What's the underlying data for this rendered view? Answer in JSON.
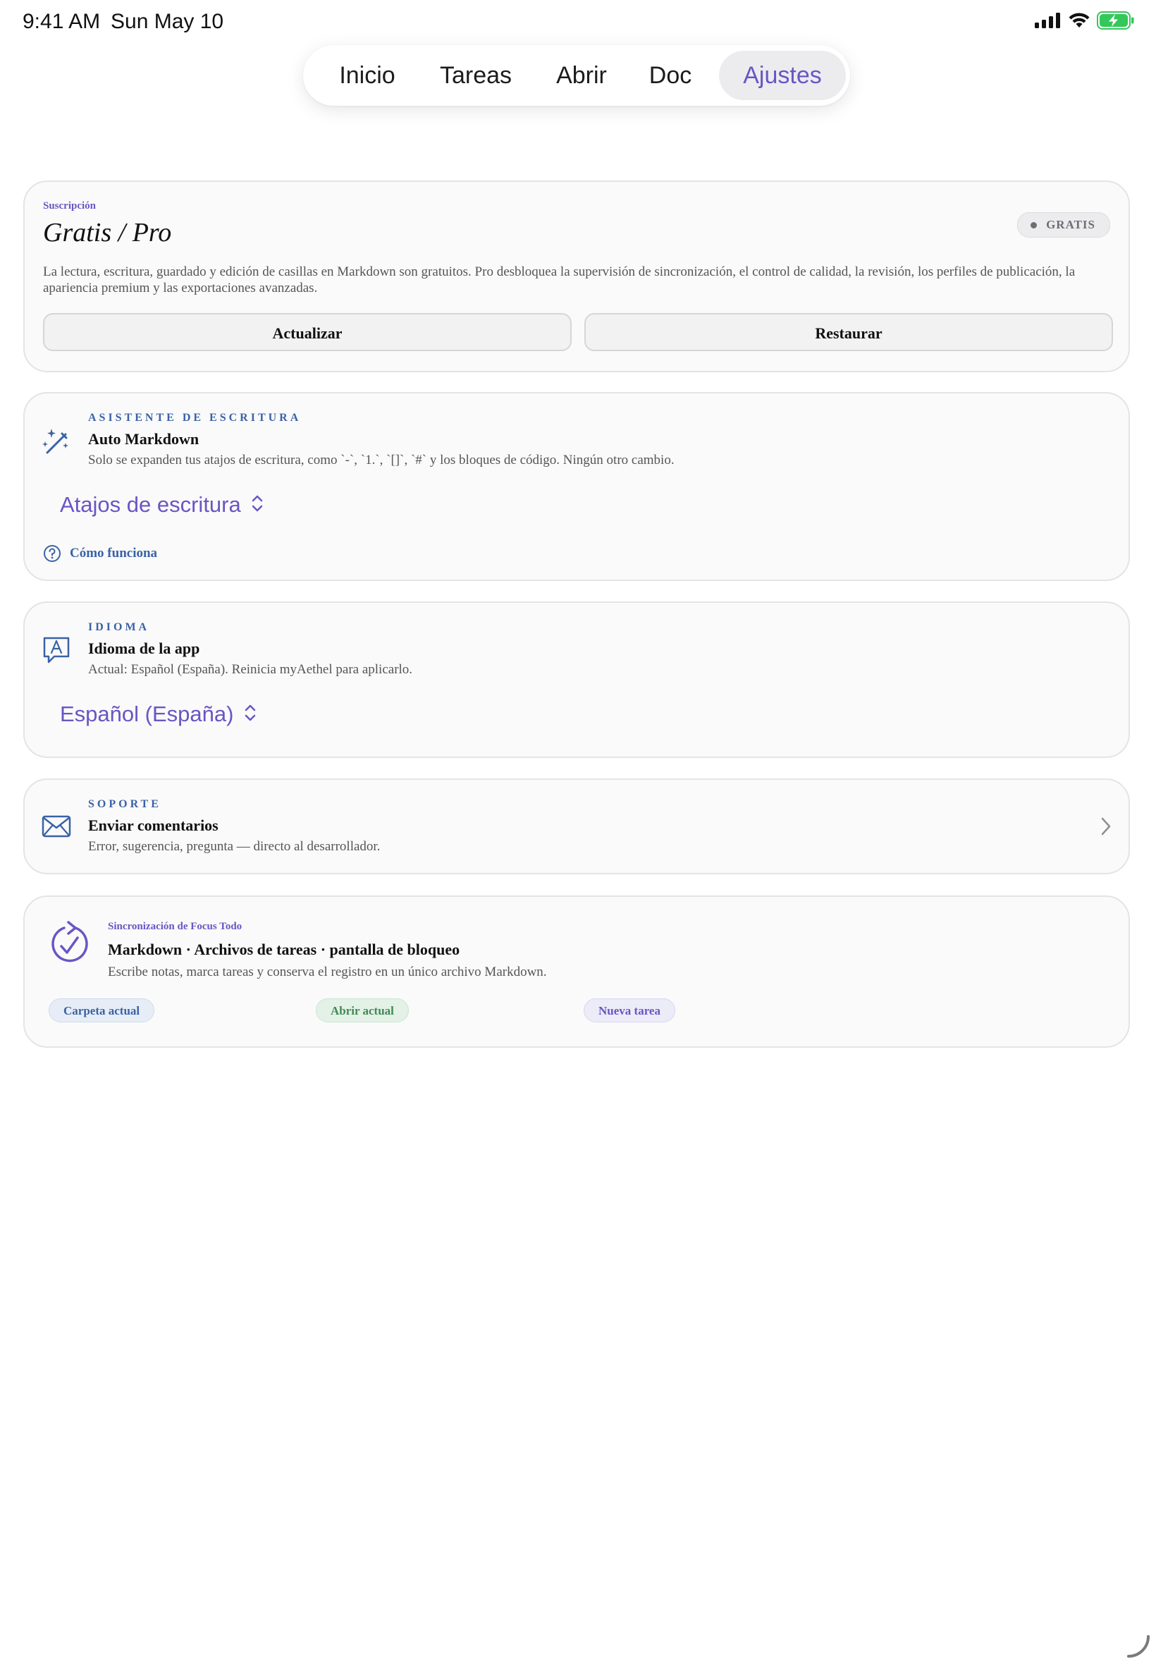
{
  "status_bar": {
    "time": "9:41 AM",
    "date": "Sun May 10"
  },
  "tabs": [
    {
      "label": "Inicio"
    },
    {
      "label": "Tareas"
    },
    {
      "label": "Abrir"
    },
    {
      "label": "Doc"
    },
    {
      "label": "Ajustes"
    }
  ],
  "subscription": {
    "eyebrow": "Suscripción",
    "title": "Gratis / Pro",
    "badge": "GRATIS",
    "description": "La lectura, escritura, guardado y edición de casillas en Markdown son gratuitos. Pro desbloquea la supervisión de sincronización, el control de calidad, la revisión, los perfiles de publicación, la apariencia premium y las exportaciones avanzadas.",
    "upgrade_label": "Actualizar",
    "restore_label": "Restaurar"
  },
  "writing_assistant": {
    "eyebrow": "ASISTENTE DE ESCRITURA",
    "title": "Auto Markdown",
    "description": "Solo se expanden tus atajos de escritura, como `-`, `1.`, `[]`, `#` y los bloques de código. Ningún otro cambio.",
    "picker_value": "Atajos de escritura",
    "help_label": "Cómo funciona"
  },
  "language": {
    "eyebrow": "IDIOMA",
    "title": "Idioma de la app",
    "description": "Actual: Español (España). Reinicia myAethel para aplicarlo.",
    "picker_value": "Español (España)"
  },
  "support": {
    "eyebrow": "SOPORTE",
    "title": "Enviar comentarios",
    "description": "Error, sugerencia, pregunta — directo al desarrollador."
  },
  "focus_sync": {
    "eyebrow": "Sincronización de Focus Todo",
    "title": "Markdown · Archivos de tareas · pantalla de bloqueo",
    "description": "Escribe notas, marca tareas y conserva el registro en un único archivo Markdown.",
    "chips": [
      {
        "label": "Carpeta actual"
      },
      {
        "label": "Abrir actual"
      },
      {
        "label": "Nueva tarea"
      }
    ]
  },
  "colors": {
    "accent": "#6a55c4",
    "blue": "#3a62a6",
    "battery": "#34c759"
  }
}
